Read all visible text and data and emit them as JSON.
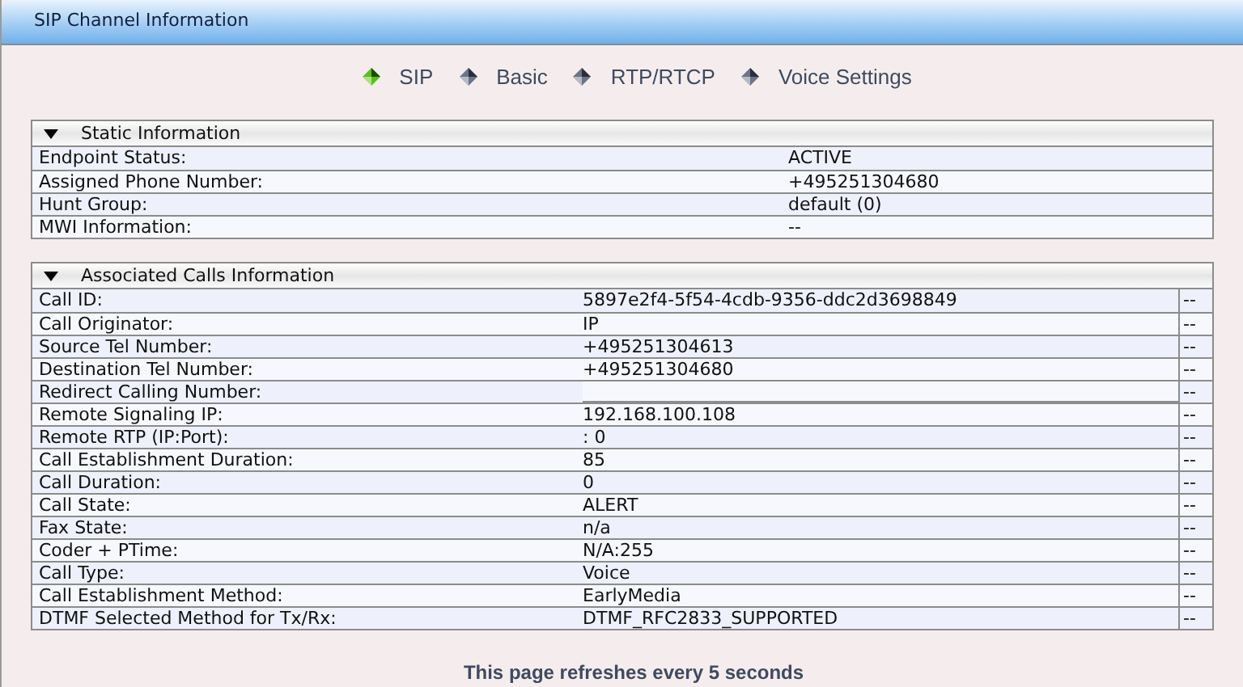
{
  "window": {
    "title": "SIP Channel Information"
  },
  "tabs": [
    {
      "label": "SIP",
      "selected": true
    },
    {
      "label": "Basic",
      "selected": false
    },
    {
      "label": "RTP/RTCP",
      "selected": false
    },
    {
      "label": "Voice Settings",
      "selected": false
    }
  ],
  "sections": [
    {
      "title": "Static Information",
      "expanded": true,
      "rows": [
        {
          "label": "Endpoint Status:",
          "value": "ACTIVE"
        },
        {
          "label": "Assigned Phone Number:",
          "value": "+495251304680"
        },
        {
          "label": "Hunt Group:",
          "value": "default (0)"
        },
        {
          "label": "MWI Information:",
          "value": "--"
        }
      ]
    },
    {
      "title": "Associated Calls Information",
      "expanded": true,
      "rows": [
        {
          "label": "Call ID:",
          "value": "5897e2f4-5f54-4cdb-9356-ddc2d3698849",
          "column_3": "--"
        },
        {
          "label": "Call Originator:",
          "value": "IP",
          "column_3": "--"
        },
        {
          "label": "Source Tel Number:",
          "value": "+495251304613",
          "column_3": "--"
        },
        {
          "label": "Destination Tel Number:",
          "value": "+495251304680",
          "column_3": "--"
        },
        {
          "label": "Redirect Calling Number:",
          "column_3": "--"
        },
        {
          "label": "Remote Signaling IP:",
          "value": "192.168.100.108",
          "column_3": "--"
        },
        {
          "label": "Remote RTP (IP:Port):",
          "value": ": 0",
          "column_3": "--"
        },
        {
          "label": "Call Establishment Duration:",
          "value": "85",
          "column_3": "--"
        },
        {
          "label": "Call Duration:",
          "value": "0",
          "column_3": "--"
        },
        {
          "label": "Call State:",
          "value": "ALERT",
          "column_3": "--"
        },
        {
          "label": "Fax State:",
          "value": "n/a",
          "column_3": "--"
        },
        {
          "label": "Coder + PTime:",
          "value": "N/A:255",
          "column_3": "--"
        },
        {
          "label": "Call Type:",
          "value": "Voice",
          "column_3": "--"
        },
        {
          "label": "Call Establishment Method:",
          "value": "EarlyMedia",
          "column_3": "--"
        },
        {
          "label": "DTMF Selected Method for Tx/Rx:",
          "value": "DTMF_RFC2833_SUPPORTED",
          "column_3": "--"
        }
      ]
    }
  ],
  "footer": "This page refreshes every 5 seconds"
}
